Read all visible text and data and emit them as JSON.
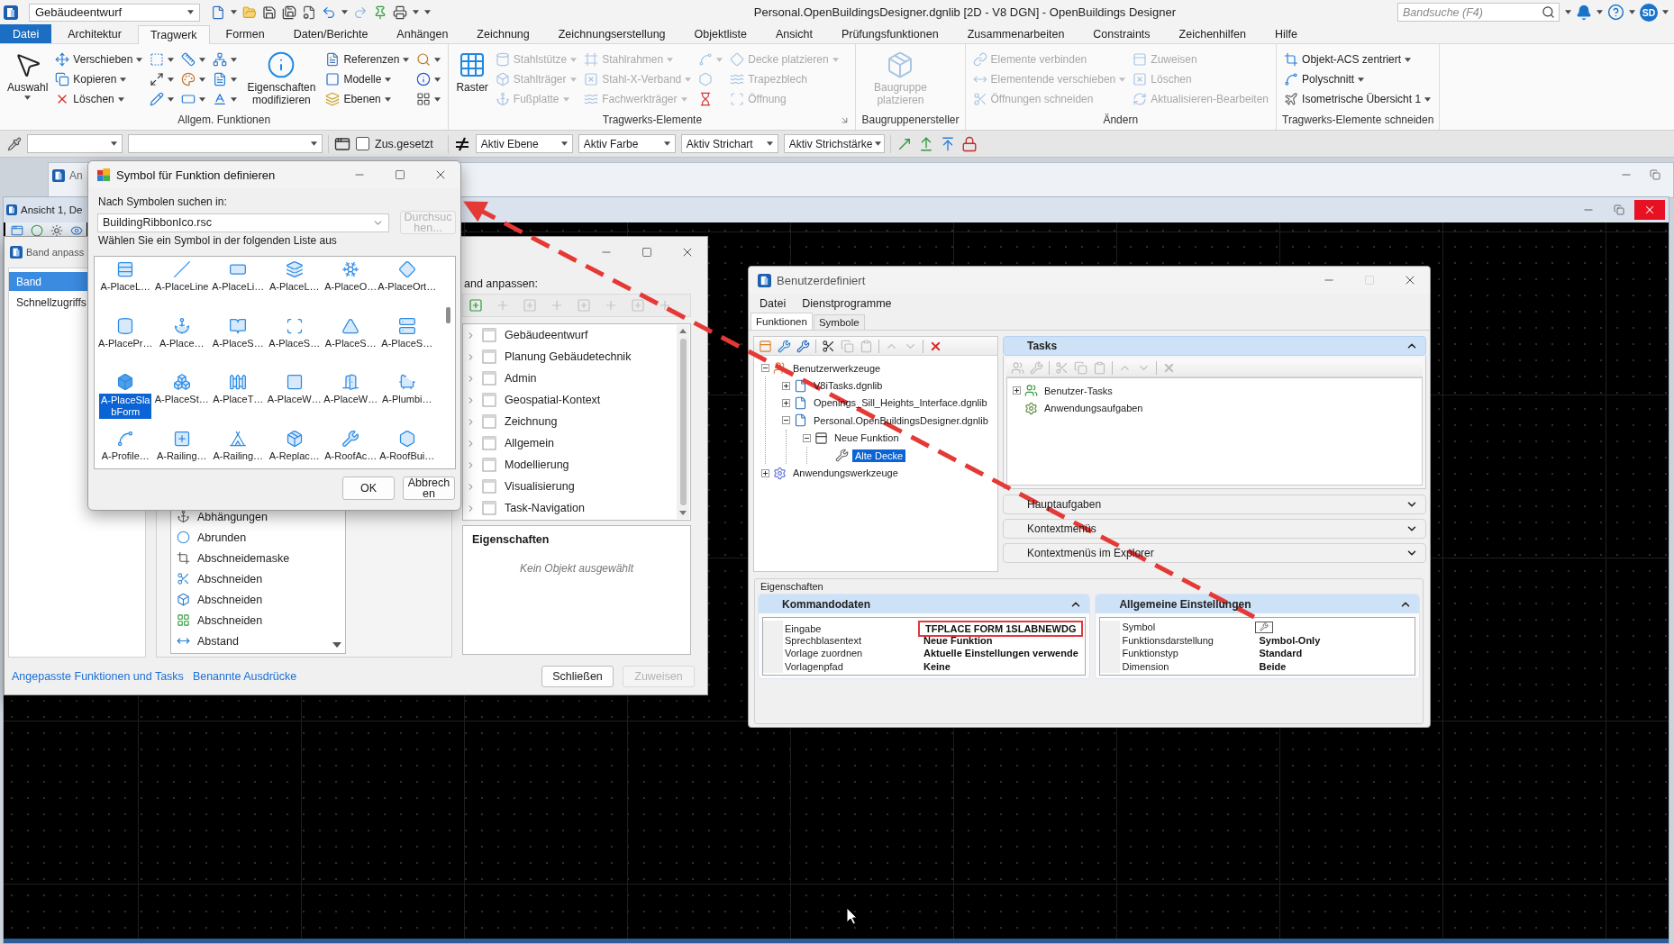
{
  "title_bar": {
    "workflow": "Gebäudeentwurf",
    "title": "Personal.OpenBuildingsDesigner.dgnlib [2D - V8 DGN] - OpenBuildings Designer",
    "search": {
      "placeholder": "Bandsuche (F4)"
    },
    "user_initials": "SD"
  },
  "ribbon_tabs": [
    {
      "label": "Datei",
      "kind": "backstage",
      "selected": false
    },
    {
      "label": "Architektur",
      "kind": "tab",
      "selected": false
    },
    {
      "label": "Tragwerk",
      "kind": "tab",
      "selected": true
    },
    {
      "label": "Formen",
      "kind": "tab",
      "selected": false
    },
    {
      "label": "Daten/Berichte",
      "kind": "tab",
      "selected": false
    },
    {
      "label": "Anhängen",
      "kind": "tab",
      "selected": false
    },
    {
      "label": "Zeichnung",
      "kind": "tab",
      "selected": false
    },
    {
      "label": "Zeichnungserstellung",
      "kind": "tab",
      "selected": false
    },
    {
      "label": "Objektliste",
      "kind": "tab",
      "selected": false
    },
    {
      "label": "Ansicht",
      "kind": "tab",
      "selected": false
    },
    {
      "label": "Prüfungsfunktionen",
      "kind": "tab",
      "selected": false
    },
    {
      "label": "Zusammenarbeiten",
      "kind": "tab",
      "selected": false
    },
    {
      "label": "Constraints",
      "kind": "tab",
      "selected": false
    },
    {
      "label": "Zeichenhilfen",
      "kind": "tab",
      "selected": false
    },
    {
      "label": "Hilfe",
      "kind": "tab",
      "selected": false
    }
  ],
  "ribbon_groups": [
    {
      "title": "Allgem. Funktionen",
      "controls": [
        {
          "kind": "large",
          "label": "Auswahl",
          "dropdown": true,
          "disabled": false
        },
        {
          "kind": "stack",
          "buttons": [
            {
              "label": "Verschieben",
              "dropdown": true,
              "disabled": false
            },
            {
              "label": "Kopieren",
              "dropdown": true,
              "disabled": false
            },
            {
              "label": "Löschen",
              "dropdown": true,
              "disabled": false
            }
          ]
        },
        {
          "kind": "stack",
          "buttons": [
            {
              "dropdown": true,
              "disabled": false
            },
            {
              "dropdown": true,
              "disabled": false
            },
            {
              "dropdown": true,
              "disabled": false
            }
          ]
        },
        {
          "kind": "stack",
          "buttons": [
            {
              "dropdown": true,
              "disabled": false
            },
            {
              "dropdown": true,
              "disabled": false
            },
            {
              "dropdown": true,
              "disabled": false
            }
          ]
        },
        {
          "kind": "stack",
          "buttons": [
            {
              "dropdown": true,
              "disabled": false
            },
            {
              "dropdown": true,
              "disabled": false
            },
            {
              "dropdown": true,
              "disabled": false
            }
          ]
        },
        {
          "kind": "large",
          "label": "Eigenschaften modifizieren",
          "dropdown": false,
          "disabled": false
        },
        {
          "kind": "stack",
          "buttons": [
            {
              "label": "Referenzen",
              "dropdown": true,
              "disabled": false
            },
            {
              "label": "Modelle",
              "dropdown": true,
              "disabled": false
            },
            {
              "label": "Ebenen",
              "dropdown": true,
              "disabled": false
            }
          ]
        },
        {
          "kind": "stack",
          "buttons": [
            {
              "dropdown": true,
              "disabled": false
            },
            {
              "dropdown": true,
              "disabled": false
            },
            {
              "dropdown": true,
              "disabled": false
            }
          ]
        }
      ]
    },
    {
      "title": "Tragwerks-Elemente",
      "launcher": true,
      "controls": [
        {
          "kind": "large",
          "label": "Raster",
          "dropdown": false,
          "disabled": false
        },
        {
          "kind": "stack",
          "buttons": [
            {
              "label": "Stahlstütze",
              "dropdown": true,
              "disabled": true
            },
            {
              "label": "Stahlträger",
              "dropdown": true,
              "disabled": true
            },
            {
              "label": "Fußplatte",
              "dropdown": true,
              "disabled": true
            }
          ]
        },
        {
          "kind": "stack",
          "buttons": [
            {
              "label": "Stahlrahmen",
              "dropdown": true,
              "disabled": true
            },
            {
              "label": "Stahl-X-Verband",
              "dropdown": true,
              "disabled": true
            },
            {
              "label": "Fachwerkträger",
              "dropdown": true,
              "disabled": true
            }
          ]
        },
        {
          "kind": "stack",
          "buttons": [
            {
              "dropdown": true,
              "disabled": true
            },
            {
              "dropdown": false,
              "disabled": true
            },
            {
              "dropdown": false,
              "disabled": false
            }
          ]
        },
        {
          "kind": "stack",
          "buttons": [
            {
              "label": "Decke platzieren",
              "dropdown": true,
              "disabled": true
            },
            {
              "label": "Trapezblech",
              "dropdown": false,
              "disabled": true
            },
            {
              "label": "Öffnung",
              "dropdown": false,
              "disabled": true
            }
          ]
        }
      ]
    },
    {
      "title": "Baugruppenersteller",
      "controls": [
        {
          "kind": "large",
          "label": "Baugruppe platzieren",
          "dropdown": false,
          "disabled": true
        }
      ]
    },
    {
      "title": "Ändern",
      "controls": [
        {
          "kind": "stack",
          "buttons": [
            {
              "label": "Elemente verbinden",
              "dropdown": false,
              "disabled": true
            },
            {
              "label": "Elementende verschieben",
              "dropdown": true,
              "disabled": true
            },
            {
              "label": "Öffnungen schneiden",
              "dropdown": false,
              "disabled": true
            }
          ]
        },
        {
          "kind": "stack",
          "buttons": [
            {
              "label": "Zuweisen",
              "dropdown": false,
              "disabled": true
            },
            {
              "label": "Löschen",
              "dropdown": false,
              "disabled": true
            },
            {
              "label": "Aktualisieren-Bearbeiten",
              "dropdown": false,
              "disabled": true
            }
          ]
        }
      ]
    },
    {
      "title": "Tragwerks-Elemente schneiden",
      "controls": [
        {
          "kind": "stack",
          "buttons": [
            {
              "label": "Objekt-ACS zentriert",
              "dropdown": true,
              "disabled": false
            },
            {
              "label": "Polyschnitt",
              "dropdown": true,
              "disabled": false
            },
            {
              "label": "Isometrische Übersicht 1",
              "dropdown": true,
              "disabled": false
            }
          ]
        }
      ]
    }
  ],
  "attribute_toolbar": {
    "checkbox": {
      "label": "Zus.gesetzt",
      "checked": false
    },
    "combos": [
      "Aktiv Ebene",
      "Aktiv Farbe",
      "Aktiv Strichart",
      "Aktiv Strichstärke"
    ]
  },
  "background_window": {
    "title": "An"
  },
  "view_window": {
    "title": "Ansicht 1, De"
  },
  "band_dialog": {
    "title": "Band anpass",
    "nav": [
      {
        "label": "Band",
        "selected": true
      },
      {
        "label": "Schnellzugriffs",
        "selected": false
      }
    ],
    "commands": [
      {
        "label": "Abhängungen",
        "selected": false
      },
      {
        "label": "Abrunden",
        "selected": false
      },
      {
        "label": "Abschneidemaske",
        "selected": false
      },
      {
        "label": "Abschneiden",
        "selected": false
      },
      {
        "label": "Abschneiden",
        "selected": false
      },
      {
        "label": "Abschneiden",
        "selected": false
      },
      {
        "label": "Abstand",
        "selected": false
      }
    ],
    "ribbon_label": "and anpassen:",
    "toolbar": [
      {
        "disabled": false
      },
      {
        "disabled": true
      },
      {
        "disabled": true
      },
      {
        "disabled": true
      },
      {
        "disabled": true
      },
      {
        "disabled": true
      },
      {
        "disabled": true
      },
      {
        "disabled": true
      }
    ],
    "ribbon_tree": [
      {
        "label": "Gebäudeentwurf",
        "expanded": false,
        "selected": false
      },
      {
        "label": "Planung Gebäudetechnik",
        "expanded": false,
        "selected": false
      },
      {
        "label": "Admin",
        "expanded": false,
        "selected": false
      },
      {
        "label": "Geospatial-Kontext",
        "expanded": false,
        "selected": false
      },
      {
        "label": "Zeichnung",
        "expanded": false,
        "selected": false
      },
      {
        "label": "Allgemein",
        "expanded": false,
        "selected": false
      },
      {
        "label": "Modellierung",
        "expanded": false,
        "selected": false
      },
      {
        "label": "Visualisierung",
        "expanded": false,
        "selected": false
      },
      {
        "label": "Task-Navigation",
        "expanded": false,
        "selected": false
      }
    ],
    "properties": {
      "title": "Eigenschaften",
      "message": "Kein Objekt ausgewählt"
    },
    "links": [
      "Angepasste Funktionen und Tasks",
      "Benannte Ausdrücke"
    ],
    "buttons": [
      {
        "label": "Schließen",
        "disabled": false
      },
      {
        "label": "Zuweisen",
        "disabled": true
      }
    ]
  },
  "symbol_dialog": {
    "title": "Symbol für Funktion definieren",
    "search_label": "Nach Symbolen suchen in:",
    "source": "BuildingRibbonIco.rsc",
    "browse": {
      "label": "Durchsuchen...",
      "disabled": true
    },
    "list_label": "Wählen Sie ein Symbol in der folgenden Liste aus",
    "symbols": [
      {
        "label": "A-PlaceL…",
        "selected": false
      },
      {
        "label": "A-PlaceLine",
        "selected": false
      },
      {
        "label": "A-PlaceLi…",
        "selected": false
      },
      {
        "label": "A-PlaceL…",
        "selected": false
      },
      {
        "label": "A-PlaceO…",
        "selected": false
      },
      {
        "label": "A-PlaceOrt…",
        "selected": false
      },
      {
        "label": "A-PlacePr…",
        "selected": false
      },
      {
        "label": "A-Place…",
        "selected": false
      },
      {
        "label": "A-PlaceS…",
        "selected": false
      },
      {
        "label": "A-PlaceS…",
        "selected": false
      },
      {
        "label": "A-PlaceS…",
        "selected": false
      },
      {
        "label": "A-PlaceS…",
        "selected": false
      },
      {
        "label": "A-PlaceSlabForm",
        "selected": true
      },
      {
        "label": "A-PlaceSt…",
        "selected": false
      },
      {
        "label": "A-PlaceT…",
        "selected": false
      },
      {
        "label": "A-PlaceW…",
        "selected": false
      },
      {
        "label": "A-PlaceW…",
        "selected": false
      },
      {
        "label": "A-Plumbi…",
        "selected": false
      },
      {
        "label": "A-Profile…",
        "selected": false
      },
      {
        "label": "A-Railing…",
        "selected": false
      },
      {
        "label": "A-Railing…",
        "selected": false
      },
      {
        "label": "A-Replac…",
        "selected": false
      },
      {
        "label": "A-RoofAc…",
        "selected": false
      },
      {
        "label": "A-RoofBui…",
        "selected": false
      }
    ],
    "buttons": [
      {
        "label": "OK",
        "disabled": false
      },
      {
        "label": "Abbrechen",
        "disabled": false
      }
    ]
  },
  "custom_dialog": {
    "title": "Benutzerdefiniert",
    "menu": [
      "Datei",
      "Dienstprogramme"
    ],
    "tabs": [
      {
        "label": "Funktionen",
        "selected": true
      },
      {
        "label": "Symbole",
        "selected": false
      }
    ],
    "tools_toolbar": [
      {
        "disabled": false
      },
      {
        "disabled": false
      },
      {
        "disabled": false
      },
      {
        "disabled": false
      },
      {
        "disabled": true
      },
      {
        "disabled": true
      },
      {
        "disabled": true
      },
      {
        "disabled": true
      },
      {
        "disabled": false
      }
    ],
    "tools_tree": [
      {
        "label": "Benutzerwerkzeuge",
        "expanded": true,
        "selected": false,
        "children": [
          {
            "label": "V8iTasks.dgnlib",
            "expanded": false,
            "selected": false
          },
          {
            "label": "Openings_Sill_Heights_Interface.dgnlib",
            "expanded": false,
            "selected": false
          },
          {
            "label": "Personal.OpenBuildingsDesigner.dgnlib",
            "expanded": true,
            "selected": false,
            "children": [
              {
                "label": "Neue Funktion",
                "expanded": true,
                "selected": false,
                "children": [
                  {
                    "label": "Alte Decke",
                    "selected": true
                  }
                ]
              }
            ]
          }
        ]
      },
      {
        "label": "Anwendungswerkzeuge",
        "expanded": false,
        "selected": false
      }
    ],
    "tasks": {
      "title": "Tasks",
      "expanded": true,
      "toolbar": [
        {
          "disabled": true
        },
        {
          "disabled": true
        },
        {
          "disabled": true
        },
        {
          "disabled": true
        },
        {
          "disabled": true
        },
        {
          "disabled": true
        },
        {
          "disabled": true
        },
        {
          "disabled": true
        }
      ],
      "tree": [
        {
          "label": "Benutzer-Tasks",
          "expanded": false,
          "selected": false
        },
        {
          "label": "Anwendungsaufgaben",
          "selected": false
        }
      ]
    },
    "sections": [
      {
        "title": "Hauptaufgaben",
        "expanded": false
      },
      {
        "title": "Kontextmenüs",
        "expanded": false
      },
      {
        "title": "Kontextmenüs im Explorer",
        "expanded": false
      }
    ],
    "properties": {
      "title": "Eigenschaften",
      "panels": [
        {
          "title": "Kommandodaten",
          "expanded": true,
          "rows": [
            {
              "name": "Eingabe",
              "kind": "text",
              "value": "TFPLACE FORM 1SLABNEWDG",
              "highlighted": true
            },
            {
              "name": "Sprechblasentext",
              "kind": "text",
              "value": "Neue Funktion",
              "highlighted": false
            },
            {
              "name": "Vorlage zuordnen",
              "kind": "text",
              "value": "Aktuelle Einstellungen verwende",
              "highlighted": false
            },
            {
              "name": "Vorlagenpfad",
              "kind": "text",
              "value": "Keine",
              "highlighted": false
            }
          ]
        },
        {
          "title": "Allgemeine Einstellungen",
          "expanded": true,
          "rows": [
            {
              "name": "Symbol",
              "kind": "icon",
              "highlighted": false
            },
            {
              "name": "Funktionsdarstellung",
              "kind": "text",
              "value": "Symbol-Only",
              "highlighted": false
            },
            {
              "name": "Funktionstyp",
              "kind": "text",
              "value": "Standard",
              "highlighted": false
            },
            {
              "name": "Dimension",
              "kind": "text",
              "value": "Beide",
              "highlighted": false
            }
          ]
        }
      ]
    }
  }
}
